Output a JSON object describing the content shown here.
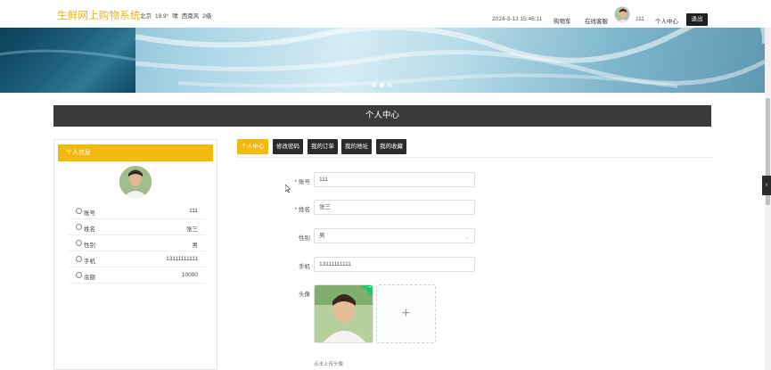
{
  "header": {
    "logo": "生鲜网上购物系统",
    "weather": {
      "city": "北京",
      "temp": "19.9°",
      "condition": "晴",
      "wind": "西南风",
      "level": "2级"
    },
    "datetime": "2024-3-13 15:46:11",
    "cart_label": "购物车",
    "service_label": "在线客服",
    "username": "111",
    "center_label": "个人中心",
    "logout_label": "退出"
  },
  "page_title": "个人中心",
  "sidebar": {
    "title": "个人信息",
    "rows": [
      {
        "label": "账号",
        "value": "111"
      },
      {
        "label": "姓名",
        "value": "张三"
      },
      {
        "label": "性别",
        "value": "男"
      },
      {
        "label": "手机",
        "value": "13111111111"
      },
      {
        "label": "余额",
        "value": "10000"
      }
    ]
  },
  "tabs": [
    {
      "label": "个人中心",
      "active": true
    },
    {
      "label": "修改密码",
      "active": false
    },
    {
      "label": "我的订单",
      "active": false
    },
    {
      "label": "我的地址",
      "active": false
    },
    {
      "label": "我的收藏",
      "active": false
    }
  ],
  "form": {
    "account": {
      "label": "账号",
      "value": "111"
    },
    "name": {
      "label": "姓名",
      "value": "张三"
    },
    "gender": {
      "label": "性别",
      "value": "男"
    },
    "phone": {
      "label": "手机",
      "value": "13111111111"
    },
    "avatar": {
      "label": "头像",
      "upload_symbol": "+",
      "hint": "点击上传头像"
    }
  },
  "colors": {
    "accent": "#f0b90b",
    "dark": "#3a3a3a",
    "logo": "#e8b318"
  }
}
